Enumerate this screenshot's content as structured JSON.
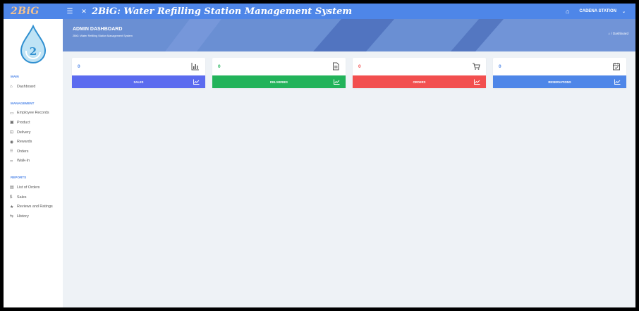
{
  "topbar": {
    "logo": "2BiG",
    "hamburger_icon": "hamburger-icon",
    "expand_icon": "expand-icon",
    "system_title": "2BiG: Water Refilling Station Management System",
    "bell_icon": "bell-icon",
    "user": "CADENA STATION",
    "user_caret": "⌄"
  },
  "sidebar": {
    "sections": [
      {
        "title": "MAIN",
        "items": [
          {
            "label": "Dashboard",
            "icon": "home-icon"
          }
        ]
      },
      {
        "title": "MANAGEMENT",
        "items": [
          {
            "label": "Employee Records",
            "icon": "calendar-icon"
          },
          {
            "label": "Product",
            "icon": "box-icon"
          },
          {
            "label": "Delivery",
            "icon": "truck-icon"
          },
          {
            "label": "Rewards",
            "icon": "gift-icon"
          },
          {
            "label": "Orders",
            "icon": "grid-icon"
          },
          {
            "label": "Walk-In",
            "icon": "walk-icon"
          }
        ]
      },
      {
        "title": "REPORTS",
        "items": [
          {
            "label": "List of Orders",
            "icon": "list-icon"
          },
          {
            "label": "Sales",
            "icon": "dollar-icon"
          },
          {
            "label": "Reviews and Ratings",
            "icon": "star-icon"
          },
          {
            "label": "History",
            "icon": "history-icon"
          }
        ]
      }
    ]
  },
  "header": {
    "title": "ADMIN DASHBOARD",
    "subtitle": "2BiG: Water Refilling Station Management System",
    "breadcrumb": "Dashboard",
    "breadcrumb_sep": "/"
  },
  "cards": [
    {
      "value": "0",
      "label": "SALES",
      "icon": "bar-chart-icon",
      "color": "#5b6bef",
      "value_color": "#4e86e8"
    },
    {
      "value": "0",
      "label": "DELIVERIES",
      "icon": "document-icon",
      "color": "#22b35a",
      "value_color": "#22b35a"
    },
    {
      "value": "0",
      "label": "ORDERS",
      "icon": "cart-icon",
      "color": "#f24f4f",
      "value_color": "#f24f4f"
    },
    {
      "value": "0",
      "label": "RESERVATIONS",
      "icon": "calendar-check-icon",
      "color": "#4e86e8",
      "value_color": "#4e86e8"
    }
  ],
  "colors": {
    "topbar": "#4e86e8",
    "banner": "#6a8fd3",
    "background": "#eef2f6"
  }
}
